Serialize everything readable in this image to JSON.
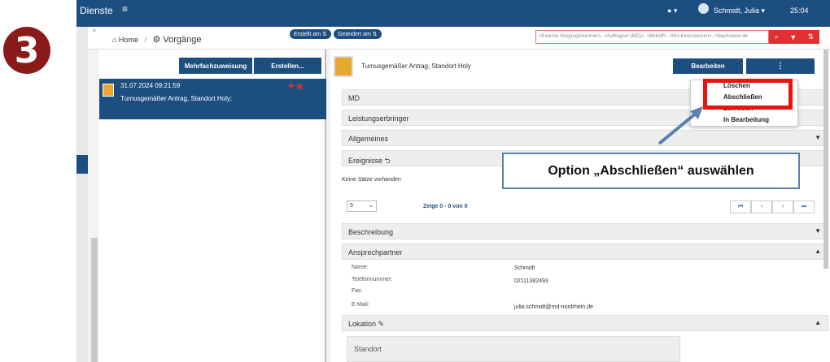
{
  "step_number": "3",
  "topbar": {
    "brand": "Dienste",
    "menu_icon": "hamburger-icon",
    "info_label": "● ▾",
    "user": "Schmidt, Julia ▾",
    "time": "25:04"
  },
  "subbar": {
    "home": "⌂ Home",
    "sep": "/",
    "page": "⚙ Vorgänge",
    "sort_created": "Erstellt am ⇅",
    "sort_changed": "Geändert am ⇅",
    "search_placeholder": "<Externe Vorgangsnummer>, <Auftragsnr.(MD)>, <Betreff>, <KH-Kennzeichen>, <Nachname de",
    "icons": [
      "search-icon",
      "filter-icon",
      "sort-icon"
    ],
    "icon_glyphs": [
      "⌕",
      "▼",
      "⇅"
    ]
  },
  "leftpanel": {
    "btn_mehrfach": "Mehrfachzuweisung",
    "btn_erstellen": "Erstellen...",
    "item": {
      "date": "31.07.2024 09:21:59",
      "title": "Turnusgemäßer Antrag, Standort Holy;",
      "flag": "✚ ▣"
    }
  },
  "detail": {
    "title": "Turnusgemäßer Antrag, Standort Holy",
    "btn_bearbeiten": "Bearbeiten",
    "btn_more": "⋮",
    "sections": {
      "md": "MD",
      "leistung": "Leistungserbringer",
      "allgemeines": "Allgemeines",
      "ereignisse": "Ereignisse ⮌",
      "beschreibung": "Beschreibung",
      "ansprech": "Ansprechpartner",
      "lokation": "Lokation ✎"
    },
    "empty_text": "Keine Sätze vorhanden",
    "page_size": "5",
    "paging": "Zeige 0 - 0 von 0",
    "pager_glyphs": [
      "⏮",
      "‹",
      "›",
      "⏭"
    ],
    "contact": {
      "name_label": "Name:",
      "name": "Schmidt",
      "tel_label": "Telefonnummer:",
      "tel": "02111382493",
      "fax_label": "Fax:",
      "mail_label": "E-Mail:",
      "mail": "julia.schmidt@md-nordrhein.de"
    },
    "standort": "Standort"
  },
  "dropdown": {
    "items": [
      "Löschen",
      "Abschließen",
      "Zuweisen",
      "In Bearbeitung"
    ]
  },
  "callout": "Option „Abschließen“ auswählen",
  "colors": {
    "primary": "#1c4e80",
    "highlight": "#ee1111",
    "step": "#8b1a1a"
  }
}
